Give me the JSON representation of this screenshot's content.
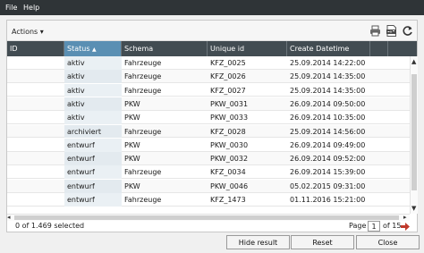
{
  "menu": {
    "file": "File",
    "help": "Help"
  },
  "toolbar": {
    "actions_label": "Actions"
  },
  "icons": [
    "printer-icon",
    "pdf-export-icon",
    "refresh-icon"
  ],
  "columns": [
    "ID",
    "Status",
    "Schema",
    "Unique id",
    "Create Datetime"
  ],
  "sort": {
    "column": "Status",
    "direction": "ascending"
  },
  "rows": [
    {
      "id": "",
      "status": "aktiv",
      "schema": "Fahrzeuge",
      "unique_id": "KFZ_0025",
      "created": "25.09.2014 14:22:00"
    },
    {
      "id": "",
      "status": "aktiv",
      "schema": "Fahrzeuge",
      "unique_id": "KFZ_0026",
      "created": "25.09.2014 14:35:00"
    },
    {
      "id": "",
      "status": "aktiv",
      "schema": "Fahrzeuge",
      "unique_id": "KFZ_0027",
      "created": "25.09.2014 14:35:00"
    },
    {
      "id": "",
      "status": "aktiv",
      "schema": "PKW",
      "unique_id": "PKW_0031",
      "created": "26.09.2014 09:50:00"
    },
    {
      "id": "",
      "status": "aktiv",
      "schema": "PKW",
      "unique_id": "PKW_0033",
      "created": "26.09.2014 10:35:00"
    },
    {
      "id": "",
      "status": "archiviert",
      "schema": "Fahrzeuge",
      "unique_id": "KFZ_0028",
      "created": "25.09.2014 14:56:00"
    },
    {
      "id": "",
      "status": "entwurf",
      "schema": "PKW",
      "unique_id": "PKW_0030",
      "created": "26.09.2014 09:49:00"
    },
    {
      "id": "",
      "status": "entwurf",
      "schema": "PKW",
      "unique_id": "PKW_0032",
      "created": "26.09.2014 09:52:00"
    },
    {
      "id": "",
      "status": "entwurf",
      "schema": "Fahrzeuge",
      "unique_id": "KFZ_0034",
      "created": "26.09.2014 15:39:00"
    },
    {
      "id": "",
      "status": "entwurf",
      "schema": "PKW",
      "unique_id": "PKW_0046",
      "created": "05.02.2015 09:31:00"
    },
    {
      "id": "",
      "status": "entwurf",
      "schema": "Fahrzeuge",
      "unique_id": "KFZ_1473",
      "created": "01.11.2016 15:21:00"
    }
  ],
  "footer": {
    "selection": "0 of 1.469 selected",
    "page_label": "Page",
    "page_value": "1",
    "page_total": "of 15"
  },
  "buttons": {
    "hide_result": "Hide result",
    "reset": "Reset",
    "close": "Close"
  },
  "colors": {
    "menubar": "#2f3437",
    "header": "#424c52",
    "sorted_header": "#5a8fb3",
    "next_arrow": "#c0392b"
  }
}
